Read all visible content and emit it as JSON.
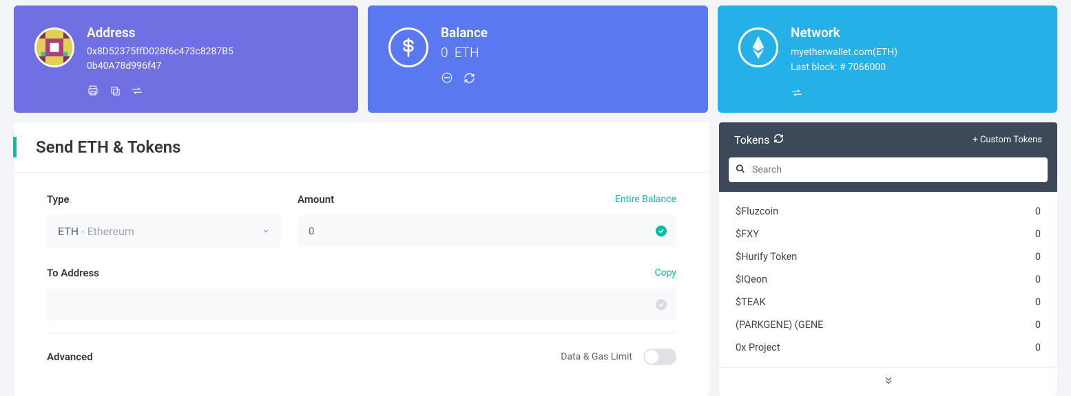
{
  "address_card": {
    "title": "Address",
    "line1": "0x8D52375ffD028f6c473c8287B5",
    "line2": "0b40A78d996f47"
  },
  "balance_card": {
    "title": "Balance",
    "amount": "0",
    "unit": "ETH"
  },
  "network_card": {
    "title": "Network",
    "provider": "myetherwallet.com(ETH)",
    "lastblock": "Last block: # 7066000"
  },
  "send": {
    "title": "Send ETH & Tokens",
    "type_label": "Type",
    "amount_label": "Amount",
    "entire_balance": "Entire Balance",
    "type_symbol": "ETH",
    "type_name": " - Ethereum",
    "amount_value": "0",
    "to_label": "To Address",
    "copy": "Copy",
    "advanced": "Advanced",
    "data_gas": "Data & Gas Limit"
  },
  "tokens_panel": {
    "title": "Tokens",
    "custom": "+ Custom Tokens",
    "search_placeholder": "Search",
    "list": [
      {
        "name": "$Fluzcoin",
        "balance": "0"
      },
      {
        "name": "$FXY",
        "balance": "0"
      },
      {
        "name": "$Hurify Token",
        "balance": "0"
      },
      {
        "name": "$IQeon",
        "balance": "0"
      },
      {
        "name": "$TEAK",
        "balance": "0"
      },
      {
        "name": "(PARKGENE) (GENE",
        "balance": "0"
      },
      {
        "name": "0x Project",
        "balance": "0"
      }
    ]
  }
}
